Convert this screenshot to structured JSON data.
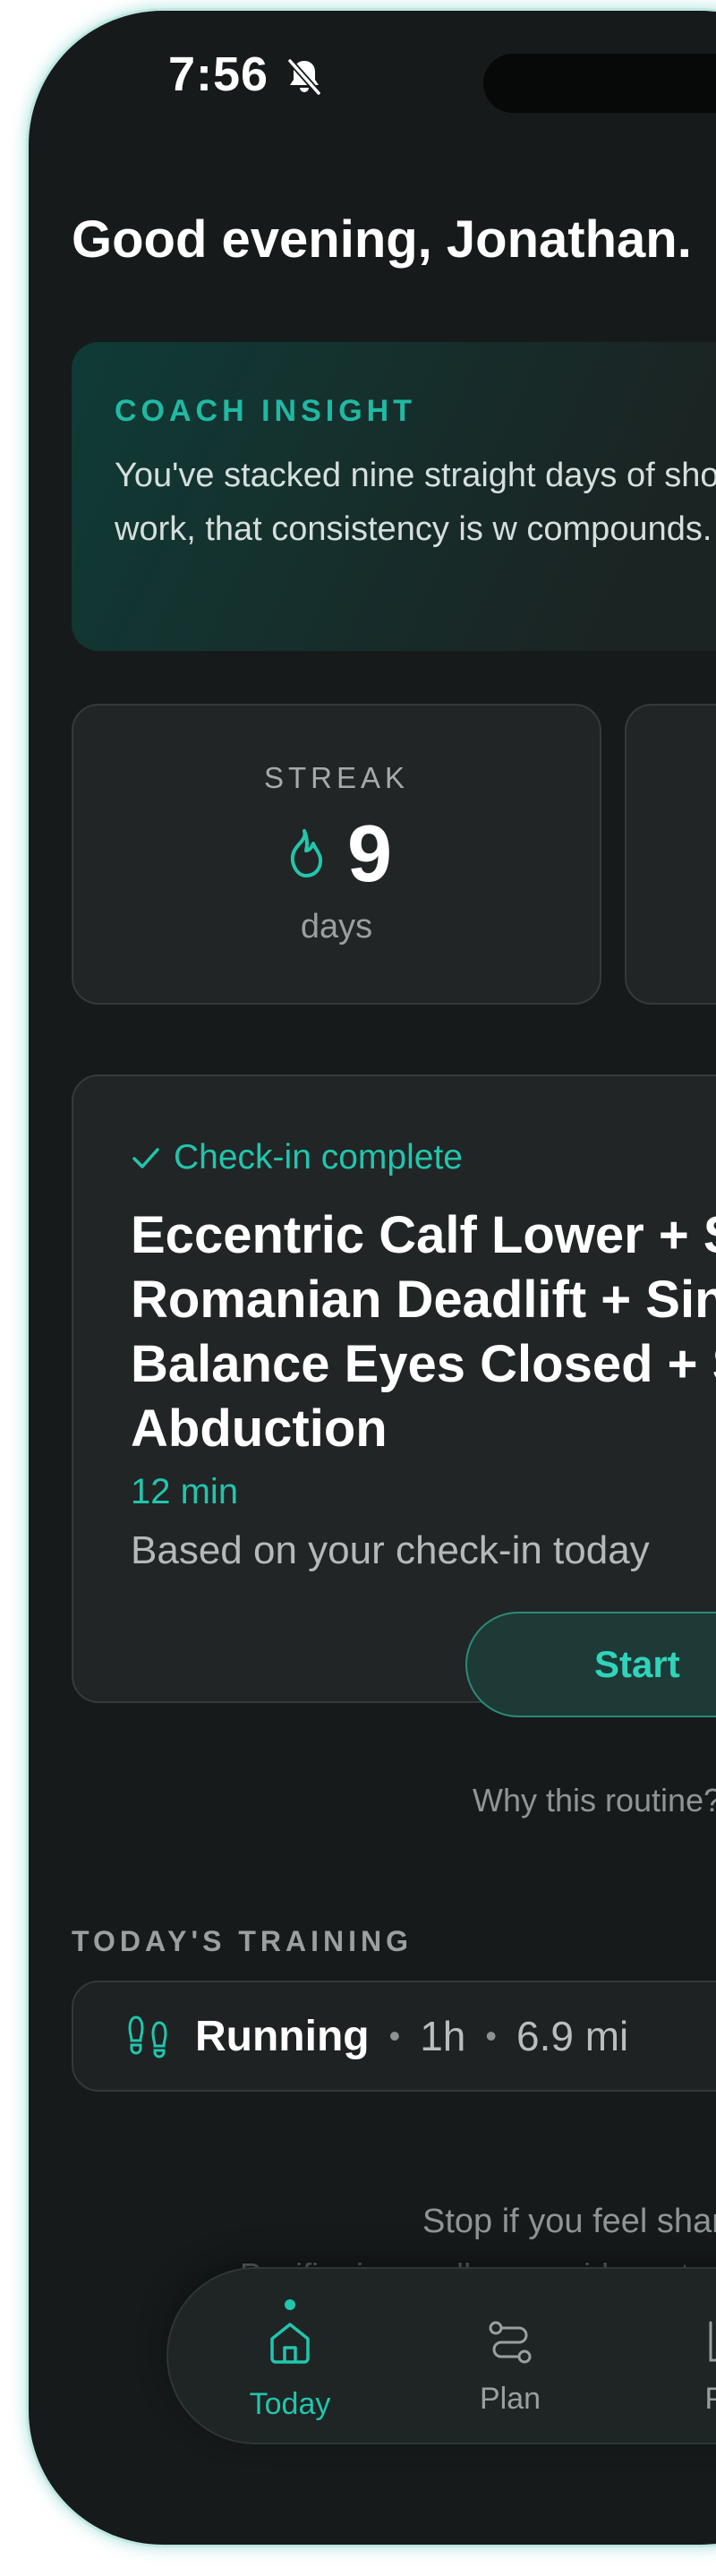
{
  "status_bar": {
    "time": "7:56",
    "icons": [
      "bell-slash-icon"
    ]
  },
  "greeting": "Good evening, Jonathan.",
  "coach_insight": {
    "title": "COACH INSIGHT",
    "text": "You've stacked nine straight days of shoulder work, that consistency is w compounds."
  },
  "stats": {
    "streak": {
      "label": "STREAK",
      "value": "9",
      "unit": "days",
      "icon": "flame-icon"
    }
  },
  "routine": {
    "status": "Check-in complete",
    "status_icon": "check-icon",
    "title": "Eccentric Calf Lower + S\nRomanian Deadlift + Sin\nBalance Eyes Closed + S\nAbduction",
    "duration": "12 min",
    "basis": "Based on your check-in today",
    "start_label": "Start",
    "why_label": "Why this routine?"
  },
  "todays_training": {
    "label": "TODAY'S TRAINING",
    "activity": {
      "name": "Running",
      "icon": "shoe-prints-icon",
      "duration": "1h",
      "distance": "6.9 mi"
    }
  },
  "safety_note": {
    "line1": "Stop if you feel shar",
    "line2": "Pacifier is a wellness guide, not a"
  },
  "tab_bar": {
    "active": "Today",
    "tabs": [
      {
        "label": "Today",
        "icon": "home-icon"
      },
      {
        "label": "Plan",
        "icon": "route-icon"
      },
      {
        "label": "Pro",
        "icon": "chart-icon"
      }
    ]
  },
  "colors": {
    "background": "#161a1a",
    "card": "#212525",
    "accent": "#22c5ad",
    "text_primary": "#ffffff",
    "text_secondary": "#a5abab"
  }
}
